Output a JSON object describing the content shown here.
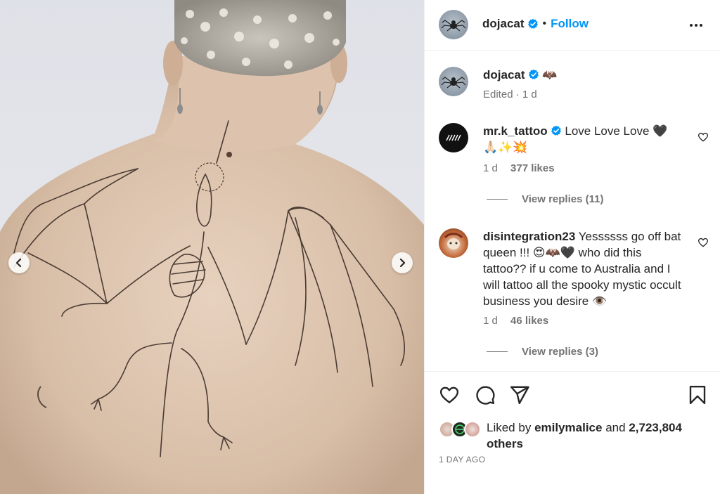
{
  "post": {
    "author": "dojacat",
    "follow_label": "Follow",
    "separator": "•"
  },
  "caption": {
    "author": "dojacat",
    "emoji": "🦇",
    "edited_label": "Edited · 1 d"
  },
  "comments": [
    {
      "user": "mr.k_tattoo",
      "text": "Love Love Love 🖤",
      "text_line2": "🙏🏻✨💥",
      "age": "1 d",
      "likes": "377 likes",
      "replies": "View replies (11)"
    },
    {
      "user": "disintegration23",
      "text": "Yessssss go off bat queen !!! 😍🦇🖤 who did this tattoo?? if u come to Australia and I will tattoo all the spooky mystic occult business you desire 👁️",
      "age": "1 d",
      "likes": "46 likes",
      "replies": "View replies (3)"
    }
  ],
  "likes_summary": {
    "prefix": "Liked by",
    "user": "emilymalice",
    "middle": "and",
    "count": "2,723,804",
    "suffix": "others"
  },
  "timestamp": "1 DAY AGO",
  "icons": {
    "prev": "chevron-left-icon",
    "next": "chevron-right-icon",
    "more": "more-options-icon",
    "like": "heart-icon",
    "comment": "comment-icon",
    "share": "share-icon",
    "save": "bookmark-icon",
    "verified": "verified-badge-icon"
  },
  "colors": {
    "accent": "#0095f6",
    "verified": "#0095f6",
    "muted": "#737373"
  }
}
